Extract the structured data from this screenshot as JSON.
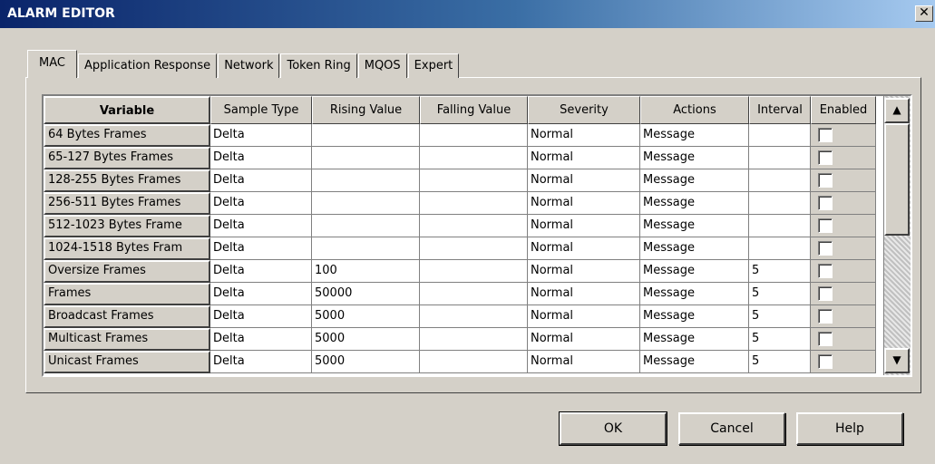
{
  "window": {
    "title": "ALARM EDITOR",
    "close_label": "✕"
  },
  "tabs": [
    "MAC",
    "Application Response",
    "Network",
    "Token Ring",
    "MQOS",
    "Expert"
  ],
  "active_tab": 0,
  "table": {
    "headers": [
      "Variable",
      "Sample Type",
      "Rising Value",
      "Falling Value",
      "Severity",
      "Actions",
      "Interval",
      "Enabled"
    ],
    "rows": [
      {
        "variable": "64 Bytes Frames",
        "sample_type": "Delta",
        "rising": "",
        "falling": "",
        "severity": "Normal",
        "actions": "Message",
        "interval": "",
        "enabled": false
      },
      {
        "variable": "65-127 Bytes Frames",
        "sample_type": "Delta",
        "rising": "",
        "falling": "",
        "severity": "Normal",
        "actions": "Message",
        "interval": "",
        "enabled": false
      },
      {
        "variable": "128-255 Bytes Frames",
        "sample_type": "Delta",
        "rising": "",
        "falling": "",
        "severity": "Normal",
        "actions": "Message",
        "interval": "",
        "enabled": false
      },
      {
        "variable": "256-511 Bytes Frames",
        "sample_type": "Delta",
        "rising": "",
        "falling": "",
        "severity": "Normal",
        "actions": "Message",
        "interval": "",
        "enabled": false
      },
      {
        "variable": "512-1023 Bytes Frame",
        "sample_type": "Delta",
        "rising": "",
        "falling": "",
        "severity": "Normal",
        "actions": "Message",
        "interval": "",
        "enabled": false
      },
      {
        "variable": "1024-1518 Bytes Fram",
        "sample_type": "Delta",
        "rising": "",
        "falling": "",
        "severity": "Normal",
        "actions": "Message",
        "interval": "",
        "enabled": false
      },
      {
        "variable": "Oversize Frames",
        "sample_type": "Delta",
        "rising": "100",
        "falling": "",
        "severity": "Normal",
        "actions": "Message",
        "interval": "5",
        "enabled": false
      },
      {
        "variable": "Frames",
        "sample_type": "Delta",
        "rising": "50000",
        "falling": "",
        "severity": "Normal",
        "actions": "Message",
        "interval": "5",
        "enabled": false
      },
      {
        "variable": "Broadcast Frames",
        "sample_type": "Delta",
        "rising": "5000",
        "falling": "",
        "severity": "Normal",
        "actions": "Message",
        "interval": "5",
        "enabled": false
      },
      {
        "variable": "Multicast Frames",
        "sample_type": "Delta",
        "rising": "5000",
        "falling": "",
        "severity": "Normal",
        "actions": "Message",
        "interval": "5",
        "enabled": false
      },
      {
        "variable": "Unicast Frames",
        "sample_type": "Delta",
        "rising": "5000",
        "falling": "",
        "severity": "Normal",
        "actions": "Message",
        "interval": "5",
        "enabled": false
      }
    ]
  },
  "scrollbar": {
    "up_icon": "▲",
    "down_icon": "▼"
  },
  "buttons": {
    "ok": "OK",
    "cancel": "Cancel",
    "help": "Help"
  },
  "colors": {
    "title_bar_start": "#0a246a",
    "title_bar_end": "#a6caf0",
    "face": "#d4d0c8"
  }
}
